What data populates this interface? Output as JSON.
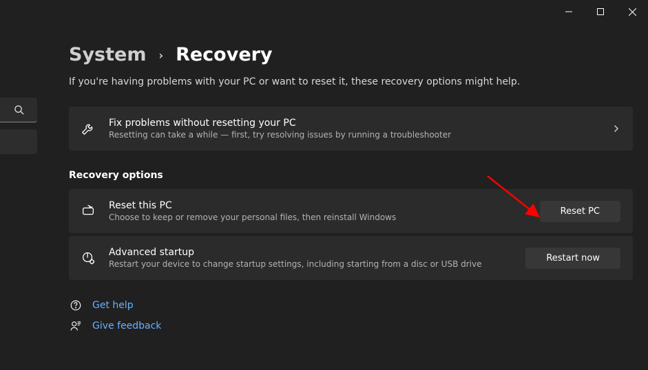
{
  "breadcrumb": {
    "parent": "System",
    "current": "Recovery"
  },
  "intro": "If you're having problems with your PC or want to reset it, these recovery options might help.",
  "troubleshoot_card": {
    "title": "Fix problems without resetting your PC",
    "subtitle": "Resetting can take a while — first, try resolving issues by running a troubleshooter"
  },
  "section_heading": "Recovery options",
  "reset_card": {
    "title": "Reset this PC",
    "subtitle": "Choose to keep or remove your personal files, then reinstall Windows",
    "button": "Reset PC"
  },
  "advanced_card": {
    "title": "Advanced startup",
    "subtitle": "Restart your device to change startup settings, including starting from a disc or USB drive",
    "button": "Restart now"
  },
  "help": {
    "get_help": "Get help",
    "feedback": "Give feedback"
  }
}
